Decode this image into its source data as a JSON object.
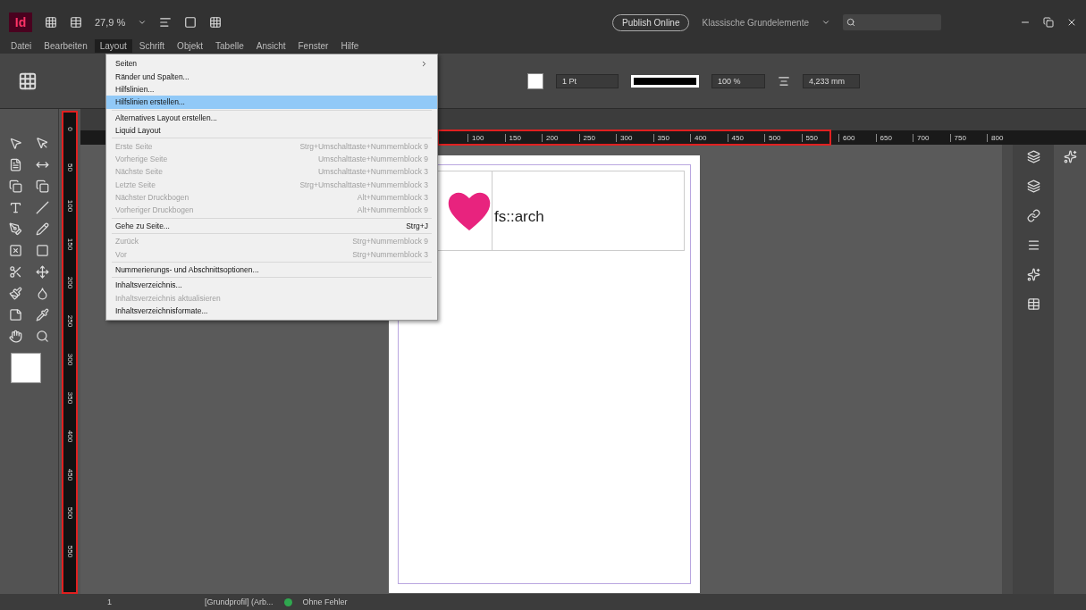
{
  "app_bar": {
    "logo": "Id",
    "zoom": "27,9 %",
    "publish_button": "Publish Online",
    "workspace": "Klassische Grundelemente"
  },
  "menu_bar": [
    {
      "label": "Datei",
      "selected": false
    },
    {
      "label": "Bearbeiten",
      "selected": false
    },
    {
      "label": "Layout",
      "selected": true
    },
    {
      "label": "Schrift",
      "selected": false
    },
    {
      "label": "Objekt",
      "selected": false
    },
    {
      "label": "Tabelle",
      "selected": false
    },
    {
      "label": "Ansicht",
      "selected": false
    },
    {
      "label": "Fenster",
      "selected": false
    },
    {
      "label": "Hilfe",
      "selected": false
    }
  ],
  "control_panel": {
    "stroke_weight": "1 Pt",
    "scale": "100 %",
    "offset": "4,233 mm"
  },
  "horizontal_ruler": [
    "100",
    "150",
    "200",
    "250",
    "300",
    "350",
    "400",
    "450",
    "500",
    "550",
    "600",
    "650",
    "700",
    "750",
    "800"
  ],
  "vertical_ruler": [
    "0",
    "50",
    "100",
    "150",
    "200",
    "250",
    "300",
    "350",
    "400",
    "450",
    "500",
    "550"
  ],
  "dropdown_menu": [
    {
      "kind": "item",
      "label": "Seiten",
      "submenu": true,
      "disabled": false,
      "selected": false
    },
    {
      "kind": "item",
      "label": "Ränder und Spalten...",
      "disabled": false,
      "selected": false
    },
    {
      "kind": "item",
      "label": "Hilfslinien...",
      "disabled": false,
      "selected": false
    },
    {
      "kind": "item",
      "label": "Hilfslinien erstellen...",
      "disabled": false,
      "selected": true
    },
    {
      "kind": "separator"
    },
    {
      "kind": "item",
      "label": "Alternatives Layout erstellen...",
      "disabled": false,
      "selected": false
    },
    {
      "kind": "item",
      "label": "Liquid Layout",
      "disabled": false,
      "selected": false
    },
    {
      "kind": "separator"
    },
    {
      "kind": "item",
      "label": "Erste Seite",
      "shortcut": "Strg+Umschalttaste+Nummernblock 9",
      "disabled": true,
      "selected": false
    },
    {
      "kind": "item",
      "label": "Vorherige Seite",
      "shortcut": "Umschalttaste+Nummernblock 9",
      "disabled": true,
      "selected": false
    },
    {
      "kind": "item",
      "label": "Nächste Seite",
      "shortcut": "Umschalttaste+Nummernblock 3",
      "disabled": true,
      "selected": false
    },
    {
      "kind": "item",
      "label": "Letzte Seite",
      "shortcut": "Strg+Umschalttaste+Nummernblock 3",
      "disabled": true,
      "selected": false
    },
    {
      "kind": "item",
      "label": "Nächster Druckbogen",
      "shortcut": "Alt+Nummernblock 3",
      "disabled": true,
      "selected": false
    },
    {
      "kind": "item",
      "label": "Vorheriger Druckbogen",
      "shortcut": "Alt+Nummernblock 9",
      "disabled": true,
      "selected": false
    },
    {
      "kind": "separator"
    },
    {
      "kind": "item",
      "label": "Gehe zu Seite...",
      "shortcut": "Strg+J",
      "disabled": false,
      "selected": false
    },
    {
      "kind": "separator"
    },
    {
      "kind": "item",
      "label": "Zurück",
      "shortcut": "Strg+Nummernblock 9",
      "disabled": true,
      "selected": false
    },
    {
      "kind": "item",
      "label": "Vor",
      "shortcut": "Strg+Nummernblock 3",
      "disabled": true,
      "selected": false
    },
    {
      "kind": "separator"
    },
    {
      "kind": "item",
      "label": "Nummerierungs- und Abschnittsoptionen...",
      "disabled": false,
      "selected": false
    },
    {
      "kind": "separator"
    },
    {
      "kind": "item",
      "label": "Inhaltsverzeichnis...",
      "disabled": false,
      "selected": false
    },
    {
      "kind": "item",
      "label": "Inhaltsverzeichnis aktualisieren",
      "disabled": true,
      "selected": false
    },
    {
      "kind": "item",
      "label": "Inhaltsverzeichnisformate...",
      "disabled": false,
      "selected": false
    }
  ],
  "page": {
    "logo_text": "fs::arch"
  },
  "status_bar": {
    "page_number": "1",
    "profile": "[Grundprofil] (Arb...",
    "preflight": "Ohne Fehler"
  }
}
